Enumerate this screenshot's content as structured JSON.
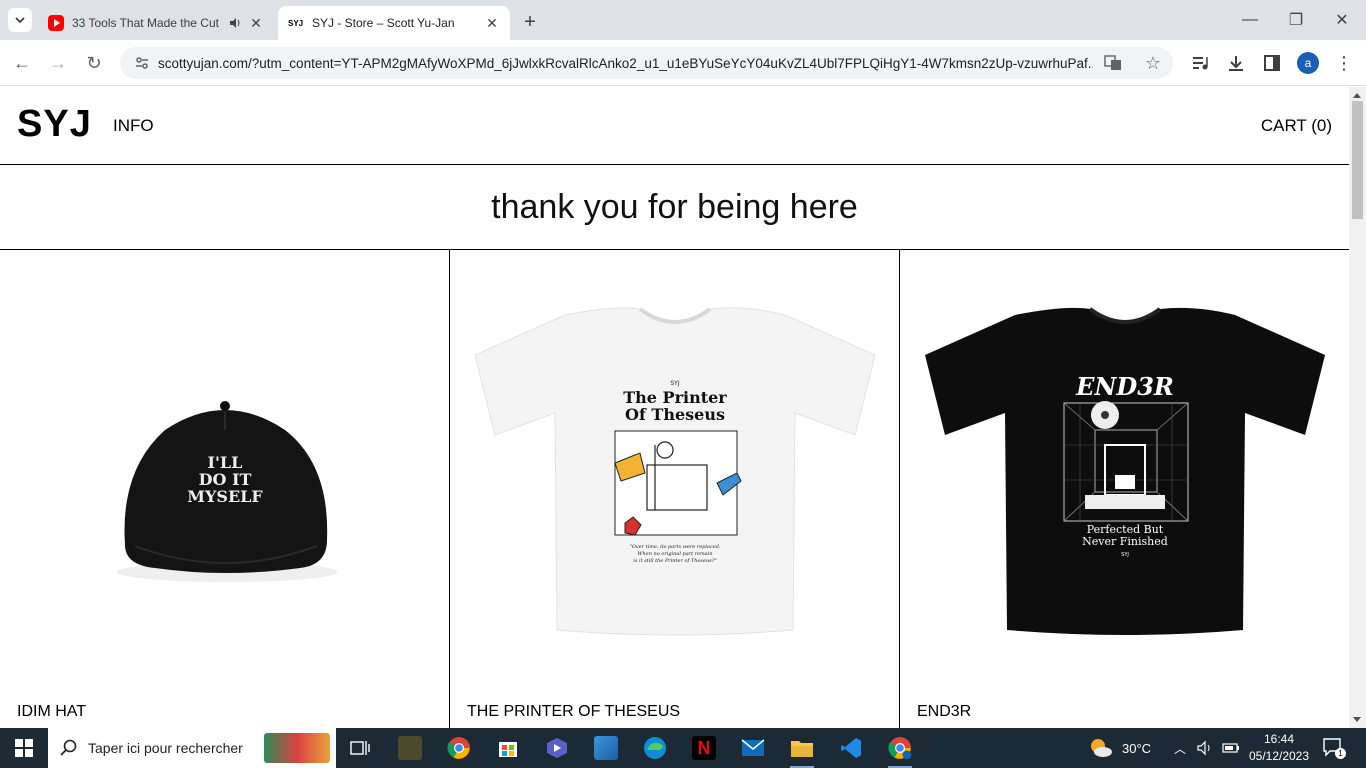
{
  "browser": {
    "tabs": [
      {
        "title": "33 Tools That Made the Cut",
        "favicon": "youtube-icon",
        "audio": true
      },
      {
        "title": "SYJ - Store – Scott Yu-Jan",
        "favicon_text": "SYJ",
        "active": true
      }
    ],
    "url": "scottyujan.com/?utm_content=YT-APM2gMAfyWoXPMd_6jJwlxkRcvalRlcAnko2_u1_u1eBYuSeYcY04uKvZL4Ubl7FPLQiHgY1-4W7kmsn2zUp-vzuwrhuPaf...",
    "profile_initial": "a"
  },
  "site": {
    "logo": "SYJ",
    "nav_info": "INFO",
    "cart": "CART (0)",
    "banner": "thank you for being here",
    "products": [
      {
        "name": "IDIM HAT",
        "hat_text": [
          "I'LL",
          "DO IT",
          "MYSELF"
        ]
      },
      {
        "name": "THE PRINTER OF THESEUS",
        "shirt_brand": "SYJ",
        "shirt_title_1": "The Printer",
        "shirt_title_2": "Of Theseus",
        "shirt_quote_1": "\"Over time, its parts were replaced.",
        "shirt_quote_2": "When no original part remain",
        "shirt_quote_3": "is it still the Printer of Theseus?\""
      },
      {
        "name": "END3R",
        "shirt_title": "END3R",
        "shirt_sub_1": "Perfected But",
        "shirt_sub_2": "Never Finished",
        "shirt_brand": "SYJ"
      }
    ]
  },
  "taskbar": {
    "search_placeholder": "Taper ici pour rechercher",
    "weather": "30°C",
    "time": "16:44",
    "date": "05/12/2023",
    "notification_count": "1"
  }
}
